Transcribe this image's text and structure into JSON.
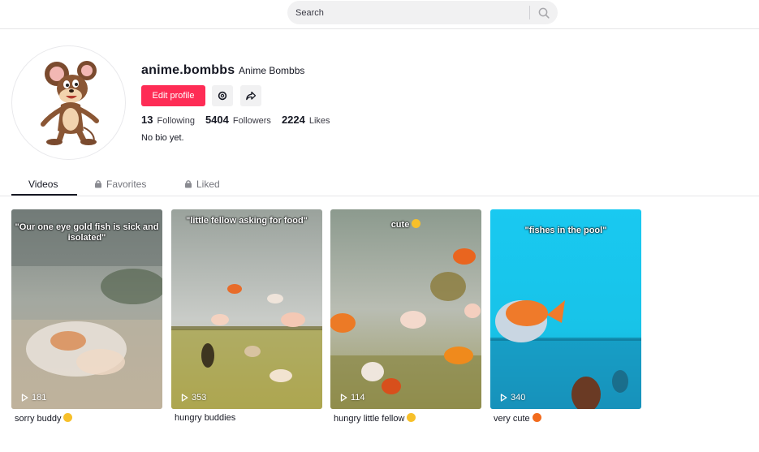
{
  "search": {
    "placeholder": "Search",
    "icon": "search-icon"
  },
  "profile": {
    "username": "anime.bombbs",
    "nickname": "Anime Bombbs",
    "edit_label": "Edit profile",
    "stats": [
      {
        "value": "13",
        "label": "Following"
      },
      {
        "value": "5404",
        "label": "Followers"
      },
      {
        "value": "2224",
        "label": "Likes"
      }
    ],
    "bio": "No bio yet."
  },
  "tabs": [
    {
      "label": "Videos",
      "locked": false,
      "active": true
    },
    {
      "label": "Favorites",
      "locked": true,
      "active": false
    },
    {
      "label": "Liked",
      "locked": true,
      "active": false
    }
  ],
  "videos": [
    {
      "overlay": "\"Our one eye gold fish is sick and isolated\"",
      "plays": "181",
      "caption": "sorry buddy",
      "emoji_color": "#f7c02a"
    },
    {
      "overlay": "\"little fellow asking for food\"",
      "plays": "353",
      "caption": "hungry buddies"
    },
    {
      "overlay": "cute",
      "plays": "114",
      "caption": "hungry little fellow",
      "emoji_color": "#f7c02a"
    },
    {
      "overlay": "\"fishes in the pool\"",
      "plays": "340",
      "caption": "very cute",
      "emoji_color": "#f26b1d"
    }
  ],
  "colors": {
    "accent": "#fe2c55",
    "text": "#161823",
    "muted": "#73747b"
  }
}
